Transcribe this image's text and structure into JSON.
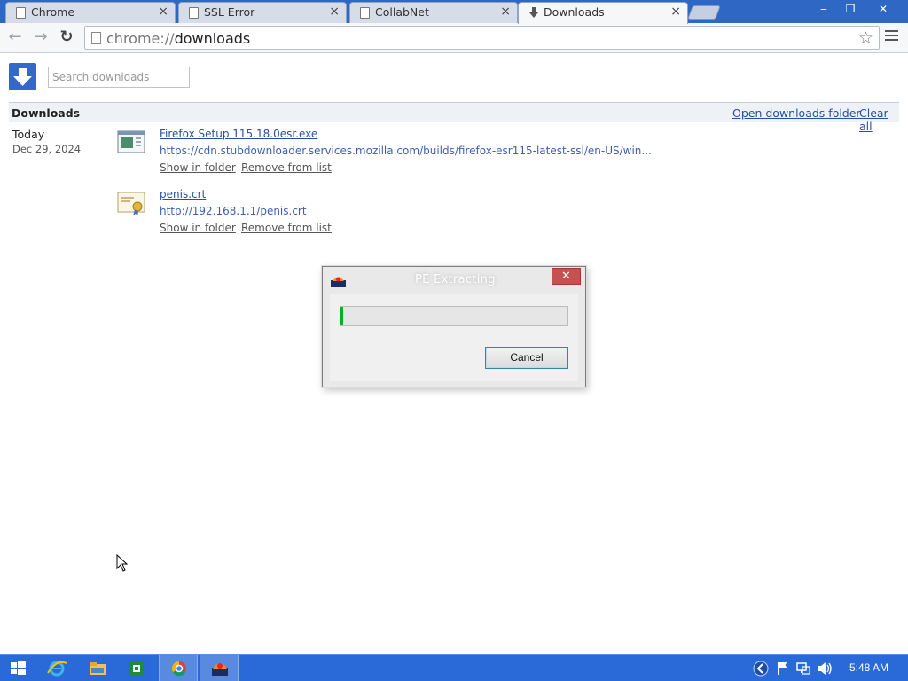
{
  "tabs": [
    {
      "title": "Chrome",
      "close": "×"
    },
    {
      "title": "SSL Error",
      "close": "×"
    },
    {
      "title": "CollabNet",
      "close": "×"
    },
    {
      "title": "Downloads",
      "close": "×"
    }
  ],
  "window_controls": {
    "minimize": "‒",
    "maximize": "❐",
    "close": "✕"
  },
  "toolbar": {
    "back": "←",
    "forward": "→",
    "reload": "↻",
    "url_scheme": "chrome://",
    "url_host": "downloads",
    "star": "☆"
  },
  "downloads_page": {
    "search_placeholder": "Search downloads",
    "section_title": "Downloads",
    "open_folder_link": "Open downloads folder",
    "clear_all_link": "Clear all",
    "date_group": {
      "day": "Today",
      "date": "Dec 29, 2024"
    },
    "items": [
      {
        "name": "Firefox Setup 115.18.0esr.exe",
        "source": "https://cdn.stubdownloader.services.mozilla.com/builds/firefox-esr115-latest-ssl/en-US/win...",
        "show_in_folder": "Show in folder",
        "remove": "Remove from list",
        "icon": "installer-file-icon"
      },
      {
        "name": "penis.crt",
        "source": "http://192.168.1.1/penis.crt",
        "show_in_folder": "Show in folder",
        "remove": "Remove from list",
        "icon": "certificate-file-icon"
      }
    ]
  },
  "dialog": {
    "title": "PE Extracting",
    "close": "✕",
    "progress": 0.005,
    "cancel_label": "Cancel"
  },
  "taskbar": {
    "clock": "5:48 AM",
    "items": [
      "start-button",
      "internet-explorer-icon",
      "file-explorer-icon",
      "excel-icon",
      "chrome-icon",
      "app-icon"
    ]
  },
  "colors": {
    "titlebar": "#2f67c4",
    "link": "#2a4da6",
    "taskbar": "#2a6ad8",
    "progress_fill": "#06b025",
    "dialog_close": "#c75050"
  }
}
